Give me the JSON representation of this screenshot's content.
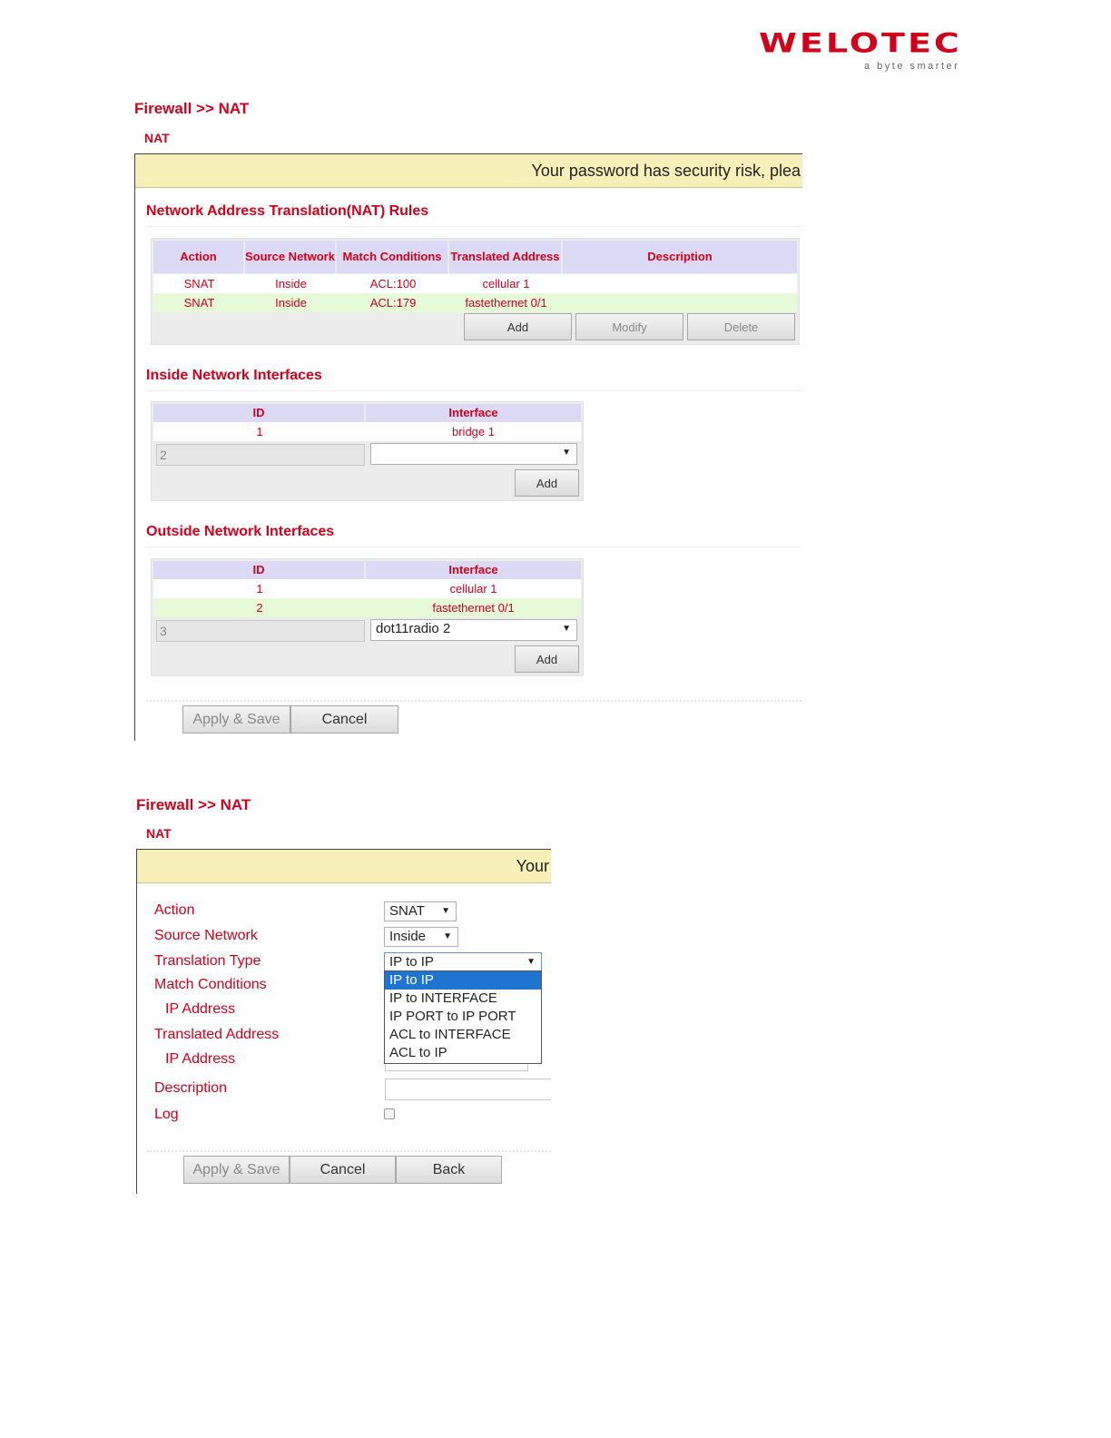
{
  "brand": {
    "name": "WELOTEC",
    "tagline": "a byte smarter",
    "accent": "#d0021b"
  },
  "screen1": {
    "breadcrumb": "Firewall >> NAT",
    "subtitle": "NAT",
    "banner": "Your password has security risk, plea",
    "rules": {
      "title": "Network Address Translation(NAT) Rules",
      "headers": [
        "Action",
        "Source Network",
        "Match Conditions",
        "Translated Address",
        "Description"
      ],
      "rows": [
        [
          "SNAT",
          "Inside",
          "ACL:100",
          "cellular 1",
          ""
        ],
        [
          "SNAT",
          "Inside",
          "ACL:179",
          "fastethernet 0/1",
          ""
        ]
      ],
      "buttons": {
        "add": "Add",
        "modify": "Modify",
        "delete": "Delete"
      }
    },
    "inside": {
      "title": "Inside Network Interfaces",
      "headers": [
        "ID",
        "Interface"
      ],
      "rows": [
        [
          "1",
          "bridge 1"
        ]
      ],
      "new_id": "2",
      "new_interface": "",
      "add": "Add"
    },
    "outside": {
      "title": "Outside Network Interfaces",
      "headers": [
        "ID",
        "Interface"
      ],
      "rows": [
        [
          "1",
          "cellular 1"
        ],
        [
          "2",
          "fastethernet 0/1"
        ]
      ],
      "new_id": "3",
      "new_interface": "dot11radio 2",
      "add": "Add"
    },
    "footer": {
      "apply": "Apply & Save",
      "cancel": "Cancel"
    }
  },
  "screen2": {
    "breadcrumb": "Firewall >> NAT",
    "subtitle": "NAT",
    "banner": "Your",
    "form": {
      "action_label": "Action",
      "action_value": "SNAT",
      "source_label": "Source Network",
      "source_value": "Inside",
      "type_label": "Translation Type",
      "type_value": "IP to IP",
      "match_label": "Match Conditions",
      "match_ip_label": "IP Address",
      "translated_label": "Translated Address",
      "translated_ip_label": "IP Address",
      "description_label": "Description",
      "log_label": "Log",
      "type_options": [
        "IP to IP",
        "IP to INTERFACE",
        "IP PORT to IP PORT",
        "ACL to INTERFACE",
        "ACL to IP"
      ]
    },
    "footer": {
      "apply": "Apply & Save",
      "cancel": "Cancel",
      "back": "Back"
    }
  }
}
